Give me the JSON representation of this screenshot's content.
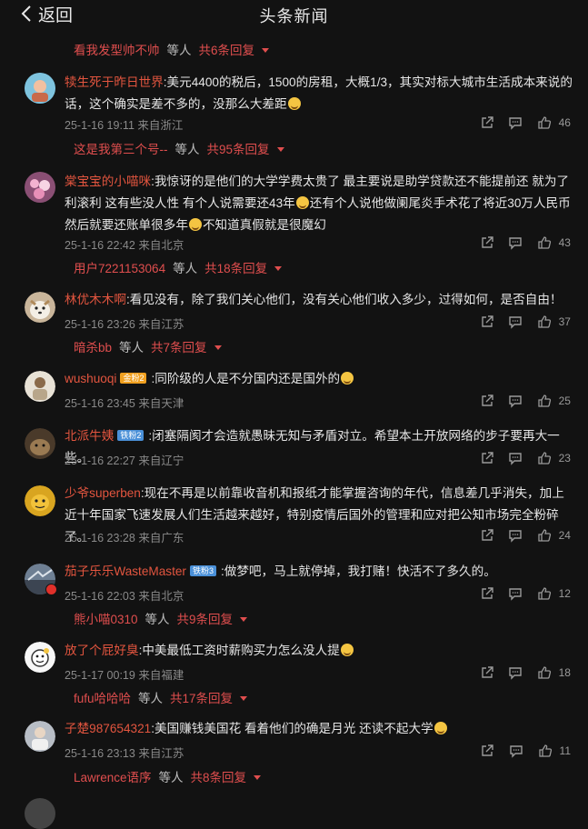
{
  "header": {
    "back_label": "返回",
    "title": "头条新闻"
  },
  "replies_header": {
    "user": "看我发型帅不帅",
    "mid": "等人",
    "count": "共6条回复"
  },
  "comments": [
    {
      "username": "犊生死于昨日世界",
      "text": "美元4400的税后，1500的房租，大概1/3，其实对标大城市生活成本来说的话，这个确实是差不多的，没那么大差距",
      "time": "25-1-16 19:11",
      "location": "来自浙江",
      "likes": "46",
      "reply": {
        "user": "这是我第三个号--",
        "mid": "等人",
        "count": "共95条回复"
      }
    },
    {
      "username": "棠宝宝的小喵咪",
      "text": "我惊讶的是他们的大学学费太贵了 最主要说是助学贷款还不能提前还 就为了利滚利 这有些没人性 有个人说需要还43年",
      "text2": "还有个人说他做阑尾炎手术花了将近30万人民币 然后就要还账单很多年",
      "text3": "不知道真假就是很魔幻",
      "time": "25-1-16 22:42",
      "location": "来自北京",
      "likes": "43",
      "reply": {
        "user": "用户7221153064",
        "mid": "等人",
        "count": "共18条回复"
      }
    },
    {
      "username": "林优木木啊",
      "text": "看见没有，除了我们关心他们，没有关心他们收入多少，过得如何，是否自由！",
      "time": "25-1-16 23:26",
      "location": "来自江苏",
      "likes": "37",
      "reply": {
        "user": "暗杀bb",
        "mid": "等人",
        "count": "共7条回复"
      }
    },
    {
      "username": "wushuoqi",
      "badge": "金粉2",
      "text": "同阶级的人是不分国内还是国外的",
      "time": "25-1-16 23:45",
      "location": "来自天津",
      "likes": "25"
    },
    {
      "username": "北派牛姨",
      "badge": "铁粉2",
      "text": "闭塞隔阂才会造就愚昧无知与矛盾对立。希望本土开放网络的步子要再大一些。",
      "time": "25-1-16 22:27",
      "location": "来自辽宁",
      "likes": "23"
    },
    {
      "username": "少爷superben",
      "text": "现在不再是以前靠收音机和报纸才能掌握咨询的年代，信息差几乎消失，加上近十年国家飞速发展人们生活越来越好，特别疫情后国外的管理和应对把公知市场完全粉碎了。",
      "time": "25-1-16 23:28",
      "location": "来自广东",
      "likes": "24"
    },
    {
      "username": "茄子乐乐WasteMaster",
      "badge": "铁粉3",
      "text": "做梦吧，马上就停掉，我打赌！快活不了多久的。",
      "time": "25-1-16 22:03",
      "location": "来自北京",
      "likes": "12",
      "reply": {
        "user": "熊小喵0310",
        "mid": "等人",
        "count": "共9条回复"
      }
    },
    {
      "username": "放了个屁好臭",
      "text": "中美最低工资时薪购买力怎么没人提",
      "time": "25-1-17 00:19",
      "location": "来自福建",
      "likes": "18",
      "reply": {
        "user": "fufu哈哈哈",
        "mid": "等人",
        "count": "共17条回复"
      }
    },
    {
      "username": "子楚987654321",
      "text": "美国赚钱美国花 看着他们的确是月光 还读不起大学",
      "time": "25-1-16 23:13",
      "location": "来自江苏",
      "likes": "11",
      "reply": {
        "user": "Lawrence语序",
        "mid": "等人",
        "count": "共8条回复"
      }
    }
  ],
  "colors": {
    "background": "#121212",
    "username": "#e3553f",
    "reply_link": "#e04e4e",
    "meta": "#8a8a8a"
  }
}
